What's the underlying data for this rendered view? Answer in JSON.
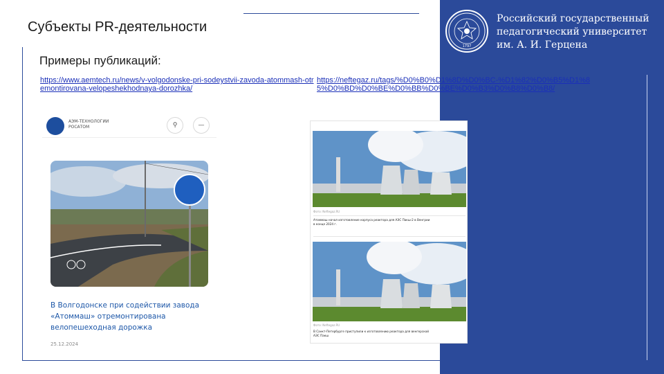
{
  "slide": {
    "title": "Субъекты PR-деятельности",
    "subtitle": "Примеры публикаций:"
  },
  "university": {
    "name_lines": [
      "Российский государственный",
      "педагогический университет",
      "им. А. И. Герцена"
    ],
    "seal_year": "1797",
    "colors": {
      "panel": "#2b4a9a",
      "text": "#ffffff"
    }
  },
  "links": [
    {
      "text": "https://www.aemtech.ru/news/v-volgodonske-pri-sodeystvii-zavoda-atommash-otremontirovana-velopeshekhodnaya-dorozhka/"
    },
    {
      "text": "https://neftegaz.ru/tags/%D0%B0%D1%8D%D0%BC-%D1%82%D0%B5%D1%85%D0%BD%D0%BE%D0%BB%D0%BE%D0%B3%D0%B8%D0%B8/"
    }
  ],
  "card1": {
    "brand_lines": [
      "АЭМ-ТЕХНОЛОГИИ",
      "РОСАТОМ"
    ],
    "search_icon": "search-icon",
    "menu_icon": "menu-icon",
    "headline_lines": [
      "В Волгодонске при содействии завода",
      "«Атоммаш» отремонтирована",
      "велопешеходная дорожка"
    ],
    "date": "25.12.2024",
    "accent": "#1d57a8"
  },
  "card2": {
    "item1": {
      "source": "Фото: Neftegaz.RU",
      "caption_lines": [
        "Атоммаш начал изготовление корпуса реактора для АЭС Пакш-2 в Венгрии",
        "в конце 2024 г."
      ]
    },
    "item2": {
      "source": "Фото: Neftegaz.RU",
      "caption_lines": [
        "В Санкт-Петербурге приступили к изготовлению реактора для венгерской",
        "АЭС Пакш"
      ]
    }
  }
}
